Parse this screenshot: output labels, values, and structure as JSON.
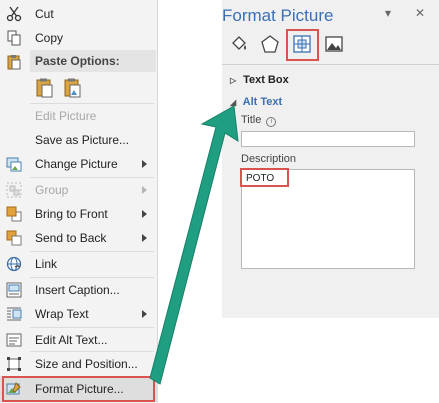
{
  "context_menu": {
    "items": [
      {
        "label": "Cut",
        "icon": "scissors-icon"
      },
      {
        "label": "Copy",
        "icon": "copy-icon"
      },
      {
        "label": "Paste Options:",
        "icon": "clipboard-icon"
      },
      {
        "label": "Edit Picture"
      },
      {
        "label": "Save as Picture..."
      },
      {
        "label": "Change Picture",
        "icon": "change-picture-icon"
      },
      {
        "label": "Group",
        "icon": "group-icon"
      },
      {
        "label": "Bring to Front",
        "icon": "bring-to-front-icon"
      },
      {
        "label": "Send to Back",
        "icon": "send-to-back-icon"
      },
      {
        "label": "Link",
        "icon": "link-icon"
      },
      {
        "label": "Insert Caption...",
        "icon": "insert-caption-icon"
      },
      {
        "label": "Wrap Text",
        "icon": "wrap-text-icon"
      },
      {
        "label": "Edit Alt Text...",
        "icon": "edit-alt-text-icon"
      },
      {
        "label": "Size and Position...",
        "icon": "size-position-icon"
      },
      {
        "label": "Format Picture...",
        "icon": "format-picture-icon"
      }
    ]
  },
  "pane": {
    "title": "Format Picture",
    "pin_glyph": "▾",
    "close_glyph": "✕",
    "sections": {
      "text_box": "Text Box",
      "alt_text": "Alt Text"
    },
    "title_label": "Title",
    "title_value": "",
    "description_label": "Description",
    "description_value": "POTO"
  },
  "colors": {
    "accent_blue": "#3b6fb6",
    "highlight_red": "#d9534f",
    "arrow_teal": "#1f9e82"
  }
}
